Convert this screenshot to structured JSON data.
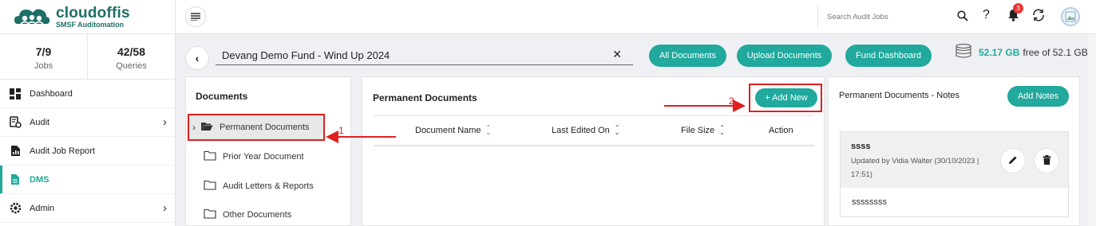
{
  "app": {
    "logo_name": "cloudoffis",
    "logo_subtitle": "SMSF Auditomation"
  },
  "stats": [
    {
      "value": "7/9",
      "label": "Jobs"
    },
    {
      "value": "42/58",
      "label": "Queries"
    }
  ],
  "nav": [
    {
      "label": "Dashboard",
      "icon": "dashboard-icon"
    },
    {
      "label": "Audit",
      "icon": "audit-icon",
      "has_chevron": true
    },
    {
      "label": "Audit Job Report",
      "icon": "report-icon"
    },
    {
      "label": "DMS",
      "icon": "document-icon",
      "active": true
    },
    {
      "label": "Admin",
      "icon": "settings-icon",
      "has_chevron": true
    }
  ],
  "topbar": {
    "search_placeholder": "Search Audit Jobs",
    "notification_count": "3"
  },
  "fund": {
    "name": "Devang Demo Fund - Wind Up 2024"
  },
  "actions": {
    "all_documents": "All Documents",
    "upload_documents": "Upload Documents",
    "fund_dashboard": "Fund Dashboard"
  },
  "storage": {
    "used": "52.17 GB",
    "suffix": "free of 52.1 GB"
  },
  "documents_panel": {
    "title": "Documents",
    "folders": [
      {
        "label": "Permanent Documents",
        "active": true
      },
      {
        "label": "Prior Year Document"
      },
      {
        "label": "Audit Letters & Reports"
      },
      {
        "label": "Other Documents"
      }
    ]
  },
  "permanent_panel": {
    "title": "Permanent Documents",
    "add_new": "+ Add New",
    "columns": [
      "Document Name",
      "Last Edited On",
      "File Size",
      "Action"
    ]
  },
  "notes_panel": {
    "title": "Permanent Documents - Notes",
    "add_notes": "Add Notes",
    "note": {
      "title": "ssss",
      "meta": "Updated by Vidia Walter (30/10/2023 | 17:51)",
      "body": "ssssssss"
    }
  },
  "annotations": {
    "step1": "1",
    "step2": "2"
  },
  "colors": {
    "accent": "#21a99d",
    "annotation": "#e02020",
    "brand": "#1e6f66"
  }
}
